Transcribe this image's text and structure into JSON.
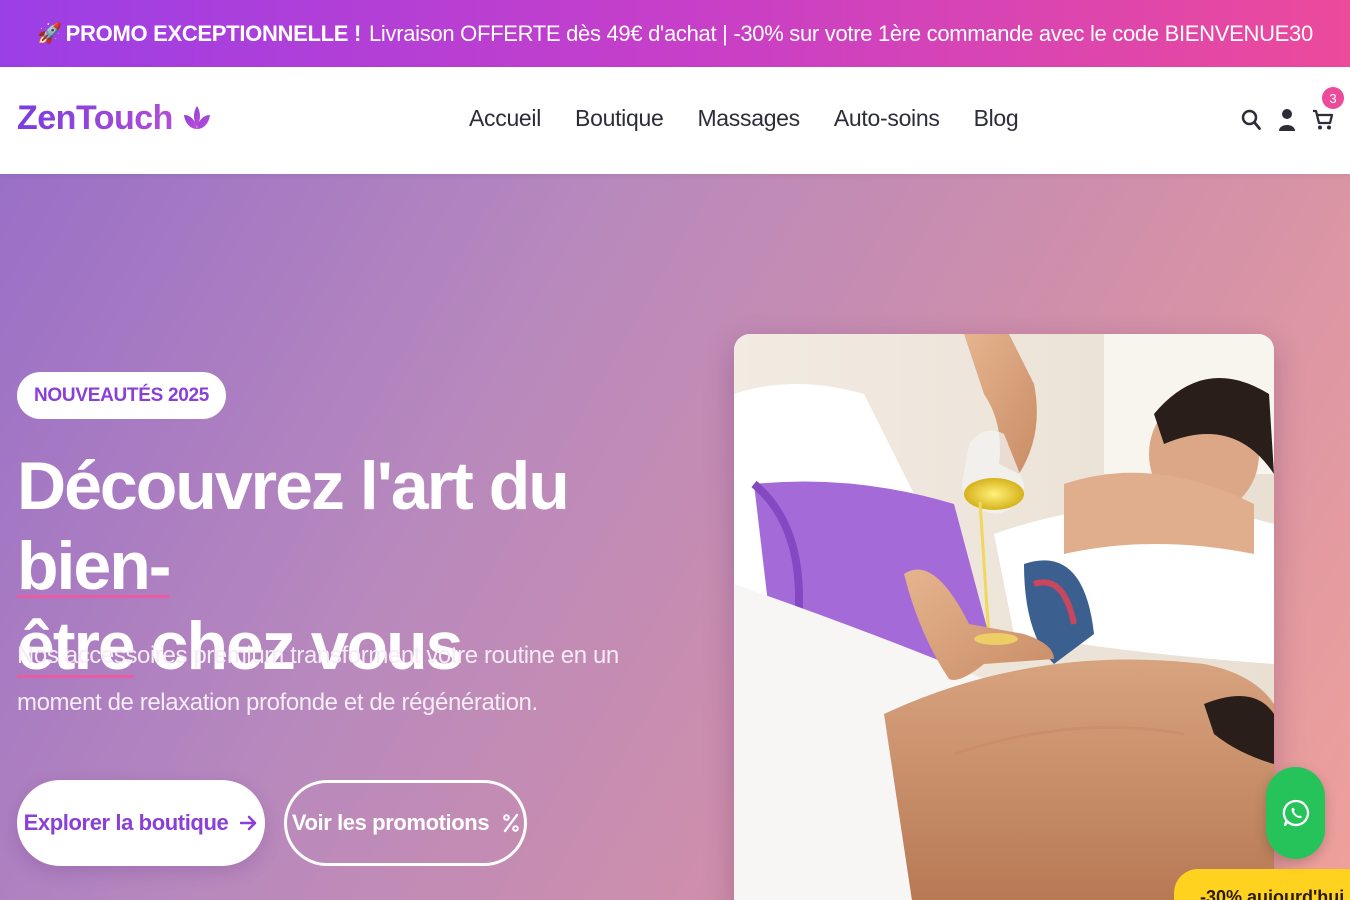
{
  "promo": {
    "rocket": "🚀",
    "highlight": "PROMO EXCEPTIONNELLE !",
    "text": "Livraison OFFERTE dès 49€ d'achat | -30% sur votre 1ère commande avec le code BIENVENUE30"
  },
  "header": {
    "logo": "ZenTouch",
    "logo_icon": "lotus-icon",
    "nav": [
      "Accueil",
      "Boutique",
      "Massages",
      "Auto-soins",
      "Blog"
    ],
    "icons": [
      "search-icon",
      "user-icon",
      "cart-icon"
    ],
    "cart_count": "3"
  },
  "hero": {
    "badge": "NOUVEAUTÉS 2025",
    "title_part1": "Découvrez l'art du ",
    "title_highlight1": "bien-",
    "title_highlight2": "être",
    "title_part2": " chez vous",
    "subtitle": "Nos accessoires premium transforment votre routine en un moment de relaxation profonde et de régénération.",
    "primary_button": "Explorer la boutique",
    "secondary_button": "Voir les promotions",
    "image": "massage-photo"
  },
  "floating": {
    "whatsapp_icon": "whatsapp-icon",
    "discount_text": "-30% aujourd'hui"
  },
  "colors": {
    "accent": "#8a3fd8",
    "pink": "#ec4a9b",
    "whatsapp": "#25c35a",
    "discount": "#ffd21f"
  }
}
